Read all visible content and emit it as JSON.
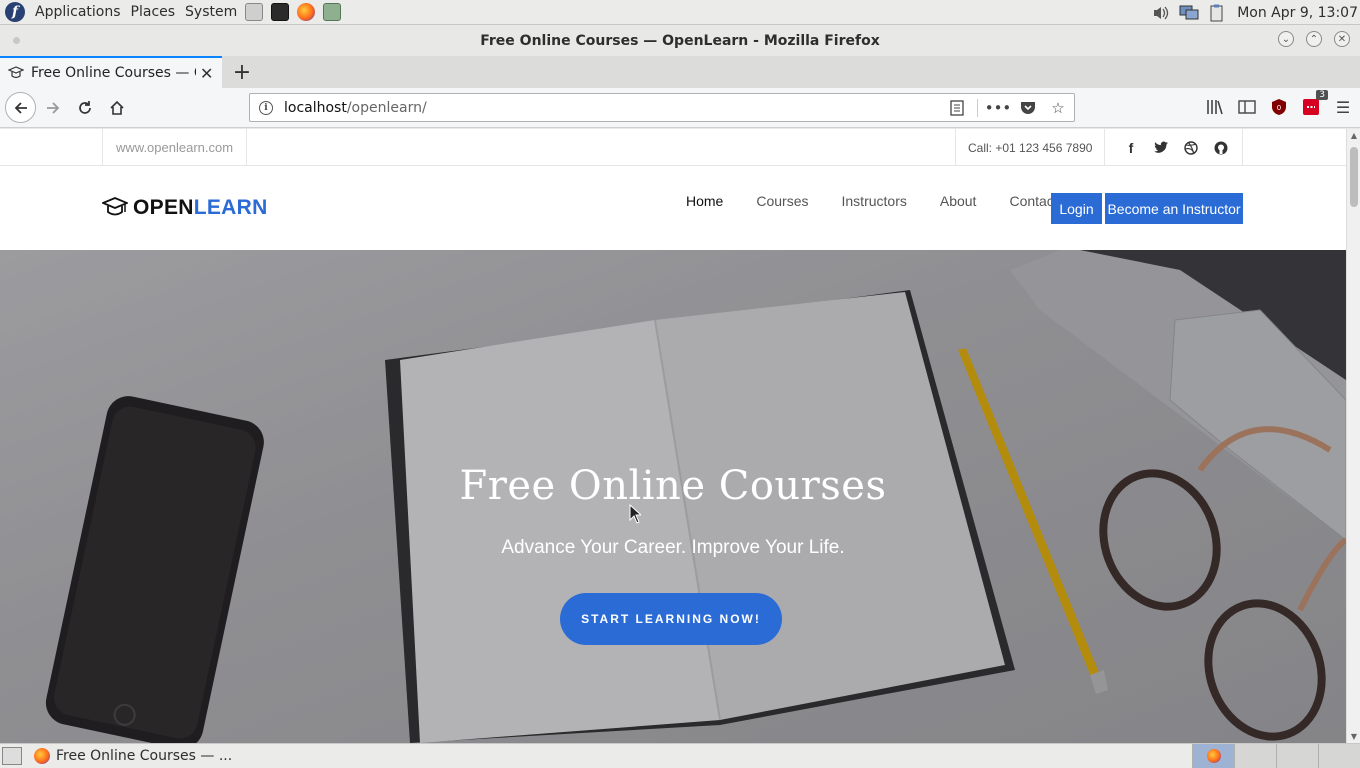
{
  "panel": {
    "menus": [
      "Applications",
      "Places",
      "System"
    ],
    "clock": "Mon Apr  9, 13:07"
  },
  "window": {
    "title": "Free Online Courses — OpenLearn - Mozilla Firefox"
  },
  "tab": {
    "title": "Free Online Courses — OpenLearn",
    "close_icon": "close-icon"
  },
  "urlbar": {
    "host": "localhost",
    "path": "/openlearn/"
  },
  "toolbar": {
    "badge_count": "3"
  },
  "site": {
    "topbar": {
      "url": "www.openlearn.com",
      "call": "Call: +01 123 456 7890",
      "socials": [
        "facebook-icon",
        "twitter-icon",
        "dribbble-icon",
        "github-icon"
      ]
    },
    "logo": {
      "part1": "OPEN",
      "part2": "LEARN"
    },
    "menu": [
      "Home",
      "Courses",
      "Instructors",
      "About",
      "Contact"
    ],
    "login_label": "Login",
    "instructor_label": "Become an Instructor",
    "hero": {
      "title": "Free Online Courses",
      "subtitle": "Advance Your Career. Improve Your Life.",
      "cta": "START LEARNING NOW!"
    },
    "colors": {
      "brand_blue": "#2a6bd6"
    }
  },
  "taskbar": {
    "task_label": "Free Online Courses — ..."
  }
}
